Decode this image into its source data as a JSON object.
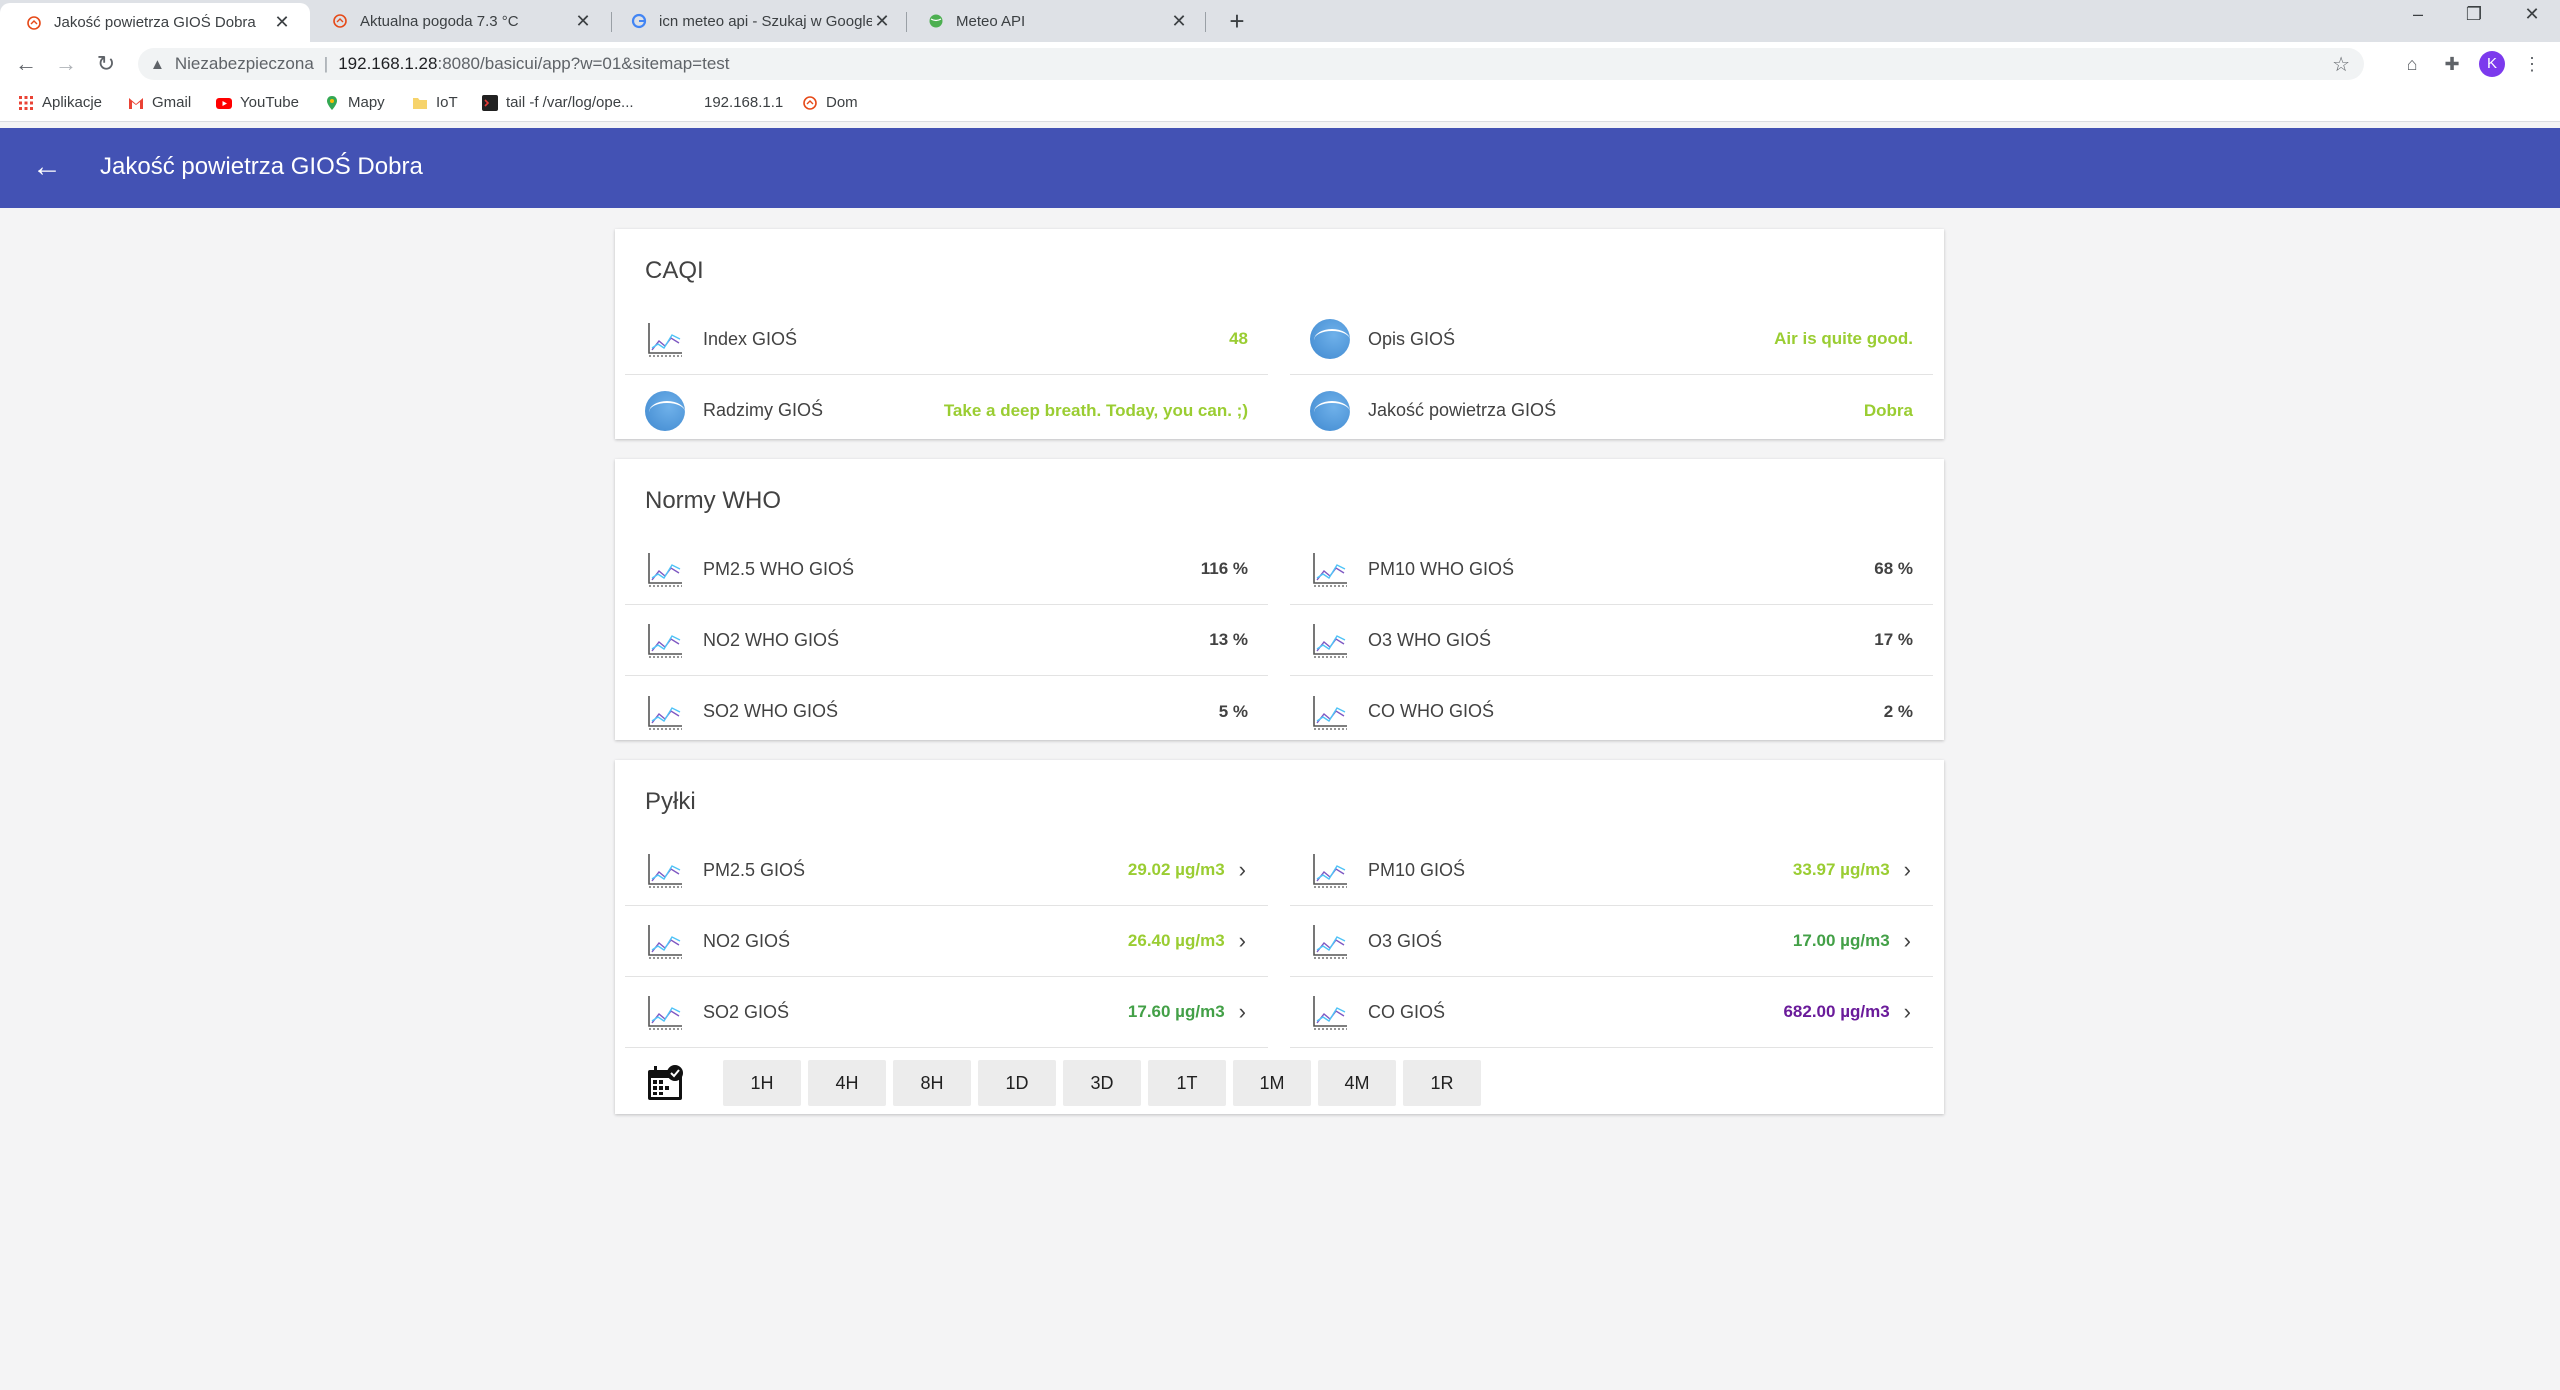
{
  "browser": {
    "tabs": [
      {
        "title": "Jakość powietrza GIOŚ Dobra",
        "active": true
      },
      {
        "title": "Aktualna pogoda 7.3 °C",
        "active": false
      },
      {
        "title": "icn meteo api - Szukaj w Google",
        "active": false
      },
      {
        "title": "Meteo API",
        "active": false
      }
    ],
    "new_tab": "+",
    "close": "✕",
    "window": {
      "minimize": "–",
      "restore": "❐",
      "close": "✕"
    },
    "address": {
      "security_label": "Niezabezpieczona",
      "separator": "|",
      "host": "192.168.1.28",
      "path": ":8080/basicui/app?w=01&sitemap=test"
    },
    "profile_initial": "K",
    "bookmarks": [
      "Aplikacje",
      "Gmail",
      "YouTube",
      "Mapy",
      "IoT",
      "tail -f /var/log/ope...",
      "192.168.1.1",
      "Dom"
    ]
  },
  "app": {
    "title": "Jakość powietrza GIOŚ Dobra",
    "back_icon": "←"
  },
  "colors": {
    "header": "#4352b4",
    "green_light": "#9acd32",
    "green": "#7cb342",
    "green_dark": "#43a047",
    "purple": "#6a1b9a"
  },
  "sections": [
    {
      "title": "CAQI",
      "rows": [
        {
          "icon": "chart-icon",
          "label": "Index GIOŚ",
          "value": "48",
          "color": "#9acd32"
        },
        {
          "icon": "globe-icon",
          "label": "Opis GIOŚ",
          "value": "Air is quite good.",
          "color": "#9acd32"
        },
        {
          "icon": "globe-icon",
          "label": "Radzimy GIOŚ",
          "value": "Take a deep breath. Today, you can. ;)",
          "color": "#9acd32"
        },
        {
          "icon": "globe-icon",
          "label": "Jakość powietrza GIOŚ",
          "value": "Dobra",
          "color": "#9acd32"
        }
      ]
    },
    {
      "title": "Normy WHO",
      "rows": [
        {
          "icon": "chart-icon",
          "label": "PM2.5 WHO GIOŚ",
          "value": "116 %",
          "color": "#424242"
        },
        {
          "icon": "chart-icon",
          "label": "PM10 WHO GIOŚ",
          "value": "68 %",
          "color": "#424242"
        },
        {
          "icon": "chart-icon",
          "label": "NO2 WHO GIOŚ",
          "value": "13 %",
          "color": "#424242"
        },
        {
          "icon": "chart-icon",
          "label": "O3 WHO GIOŚ",
          "value": "17 %",
          "color": "#424242"
        },
        {
          "icon": "chart-icon",
          "label": "SO2 WHO GIOŚ",
          "value": "5 %",
          "color": "#424242"
        },
        {
          "icon": "chart-icon",
          "label": "CO WHO GIOŚ",
          "value": "2 %",
          "color": "#424242"
        }
      ]
    },
    {
      "title": "Pyłki",
      "rows": [
        {
          "icon": "chart-icon",
          "label": "PM2.5 GIOŚ",
          "value": "29.02 µg/m3",
          "color": "#9acd32",
          "chevron": "›"
        },
        {
          "icon": "chart-icon",
          "label": "PM10 GIOŚ",
          "value": "33.97 µg/m3",
          "color": "#9acd32",
          "chevron": "›"
        },
        {
          "icon": "chart-icon",
          "label": "NO2 GIOŚ",
          "value": "26.40 µg/m3",
          "color": "#9acd32",
          "chevron": "›"
        },
        {
          "icon": "chart-icon",
          "label": "O3 GIOŚ",
          "value": "17.00 µg/m3",
          "color": "#43a047",
          "chevron": "›"
        },
        {
          "icon": "chart-icon",
          "label": "SO2 GIOŚ",
          "value": "17.60 µg/m3",
          "color": "#43a047",
          "chevron": "›"
        },
        {
          "icon": "chart-icon",
          "label": "CO GIOŚ",
          "value": "682.00 µg/m3",
          "color": "#6a1b9a",
          "chevron": "›"
        }
      ],
      "periods": [
        "1H",
        "4H",
        "8H",
        "1D",
        "3D",
        "1T",
        "1M",
        "4M",
        "1R"
      ]
    }
  ]
}
